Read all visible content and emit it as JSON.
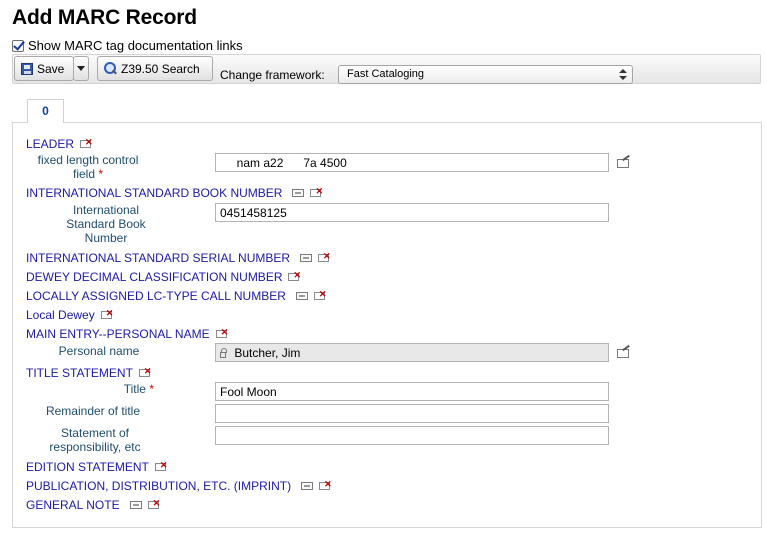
{
  "page": {
    "title": "Add MARC Record"
  },
  "options": {
    "show_doc_links_label": "Show MARC tag documentation links",
    "show_doc_links_checked": true
  },
  "toolbar": {
    "save_label": "Save",
    "z3950_label": "Z39.50 Search",
    "framework_label": "Change framework:",
    "framework_selected": "Fast Cataloging"
  },
  "tabs": [
    {
      "label": "0"
    }
  ],
  "record": {
    "leader": {
      "tag_label": "LEADER",
      "subfield_label": "fixed length control field",
      "required_mark": "*",
      "value": "     nam a22      7a 4500"
    },
    "isbn": {
      "tag_label": "INTERNATIONAL STANDARD BOOK NUMBER",
      "subfield_label": "International Standard Book Number",
      "value": "0451458125"
    },
    "issn": {
      "tag_label": "INTERNATIONAL STANDARD SERIAL NUMBER"
    },
    "ddc": {
      "tag_label": "DEWEY DECIMAL CLASSIFICATION NUMBER"
    },
    "local_lc": {
      "tag_label": "LOCALLY ASSIGNED LC-TYPE CALL NUMBER"
    },
    "local_dewey": {
      "tag_label": "Local Dewey"
    },
    "main_entry": {
      "tag_label": "MAIN ENTRY--PERSONAL NAME",
      "subfield_label": "Personal name",
      "value": "Butcher, Jim"
    },
    "title_statement": {
      "tag_label": "TITLE STATEMENT",
      "title_label": "Title",
      "required_mark": "*",
      "title_value": "Fool Moon",
      "remainder_label": "Remainder of title",
      "remainder_value": "",
      "responsibility_label": "Statement of responsibility, etc",
      "responsibility_value": ""
    },
    "edition": {
      "tag_label": "EDITION STATEMENT"
    },
    "imprint": {
      "tag_label": "PUBLICATION, DISTRIBUTION, ETC. (IMPRINT)"
    },
    "general_note": {
      "tag_label": "GENERAL NOTE"
    }
  },
  "colors": {
    "tag_text": "#1a1aa6",
    "subfield_text": "#1e4e6e",
    "tab_text": "#0b41a3",
    "required": "#cc0000"
  },
  "icons": [
    "checkbox-icon",
    "save-icon",
    "dropdown-caret-icon",
    "search-icon",
    "repeat-tag-icon",
    "delete-tag-icon",
    "tag-editor-icon",
    "lock-icon"
  ]
}
